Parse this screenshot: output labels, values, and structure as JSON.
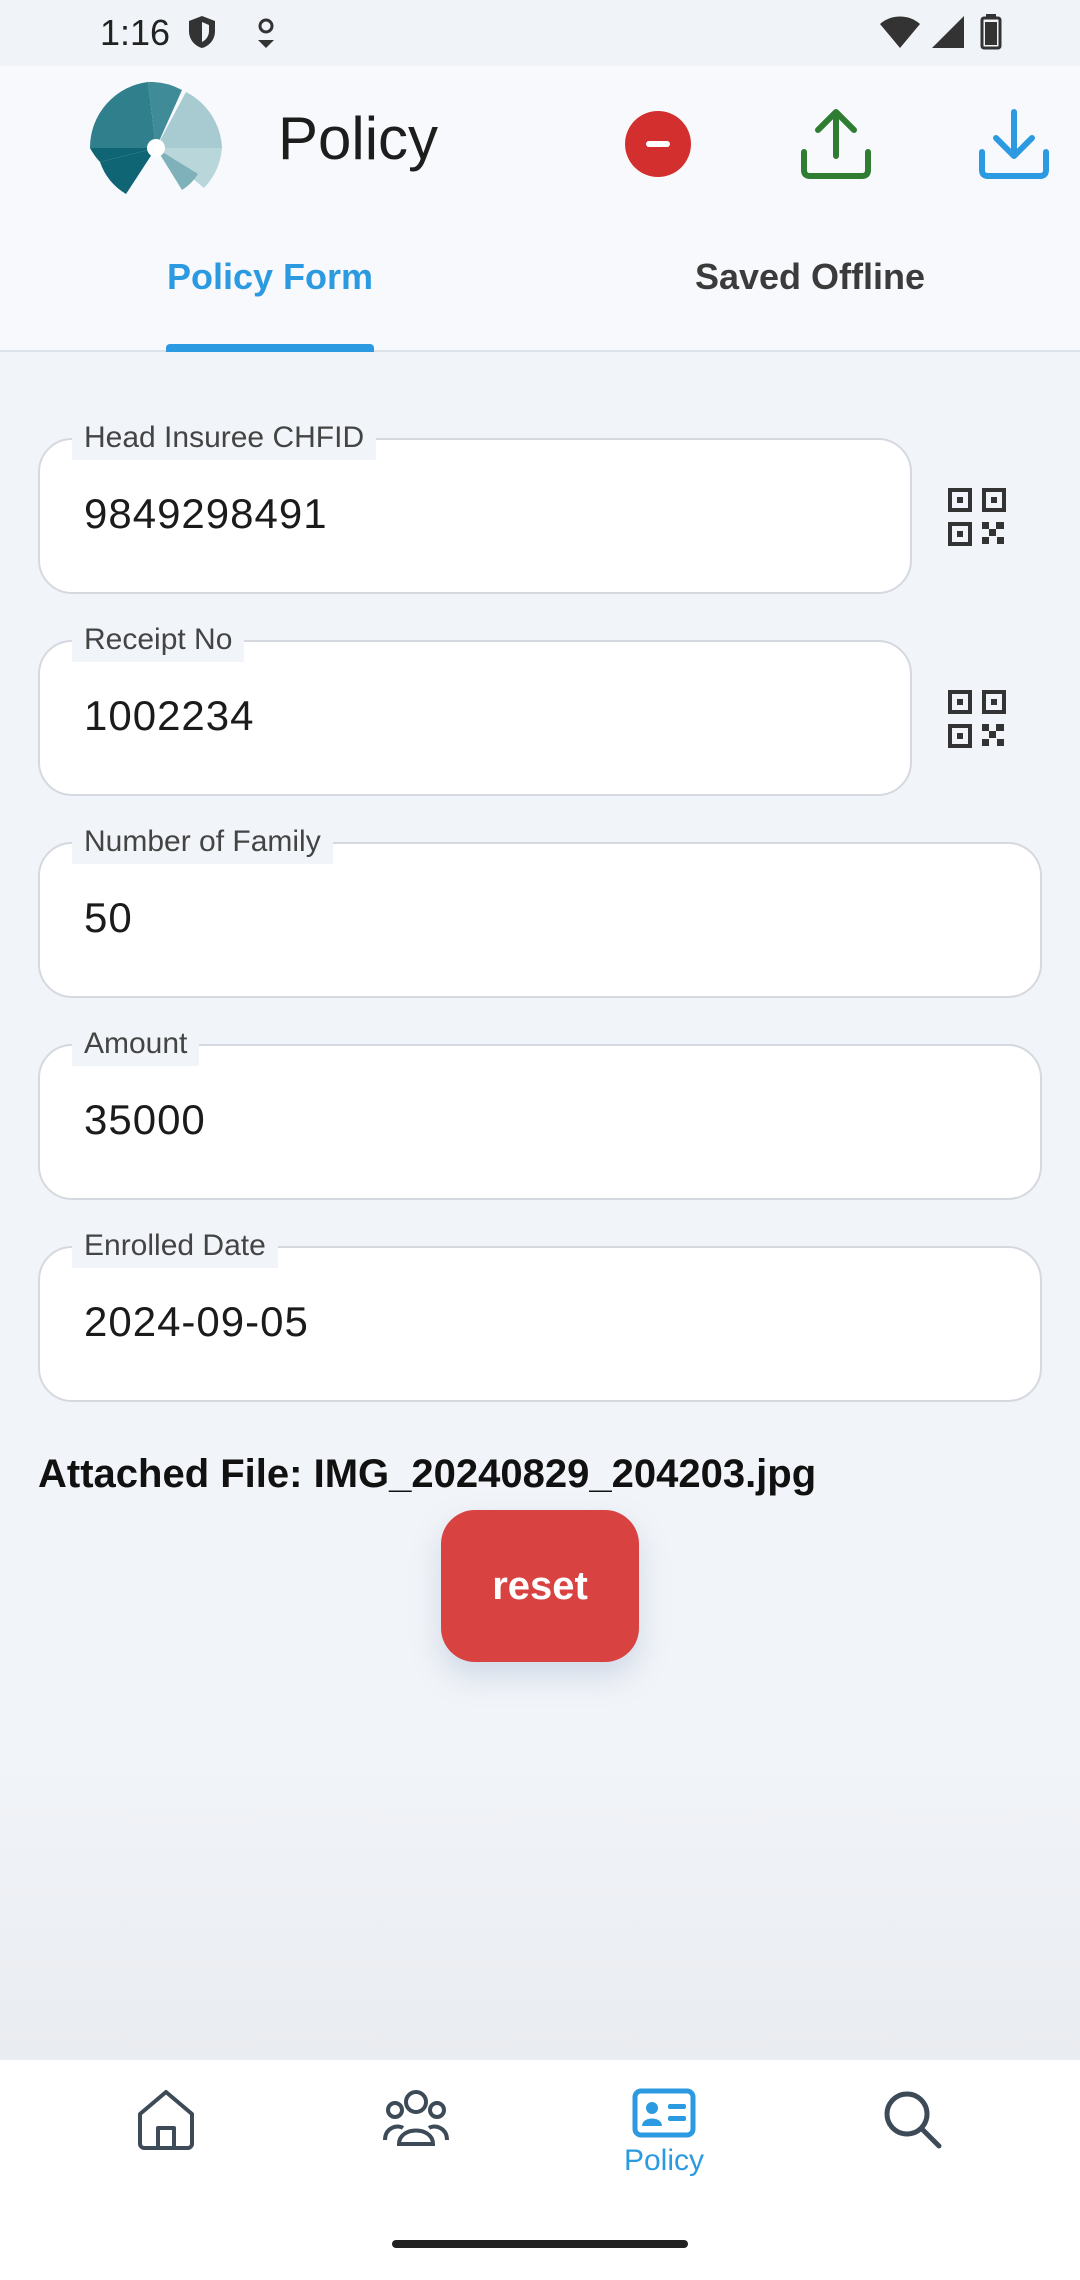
{
  "status_bar": {
    "time": "1:16"
  },
  "app_bar": {
    "title": "Policy",
    "tabs": [
      {
        "label": "Policy Form",
        "active": true
      },
      {
        "label": "Saved Offline",
        "active": false
      }
    ],
    "actions": [
      "remove-icon",
      "upload-icon",
      "download-icon"
    ]
  },
  "form": {
    "fields": [
      {
        "label": "Head Insuree CHFID",
        "value": "9849298491",
        "qr": true
      },
      {
        "label": "Receipt No",
        "value": "1002234",
        "qr": true
      },
      {
        "label": "Number of Family",
        "value": "50",
        "qr": false
      },
      {
        "label": "Amount",
        "value": "35000",
        "qr": false
      },
      {
        "label": "Enrolled Date",
        "value": "2024-09-05",
        "qr": false
      }
    ],
    "attached_file": "Attached File: IMG_20240829_204203.jpg",
    "reset_label": "reset"
  },
  "bottom_nav": {
    "items": [
      {
        "icon": "home-icon",
        "label": ""
      },
      {
        "icon": "family-icon",
        "label": ""
      },
      {
        "icon": "policy-card-icon",
        "label": "Policy",
        "active": true
      },
      {
        "icon": "search-icon",
        "label": ""
      }
    ]
  },
  "colors": {
    "accent": "#2b9ae0",
    "reset": "#d84341",
    "upload": "#2e7d32",
    "remove": "#d32f2f"
  }
}
